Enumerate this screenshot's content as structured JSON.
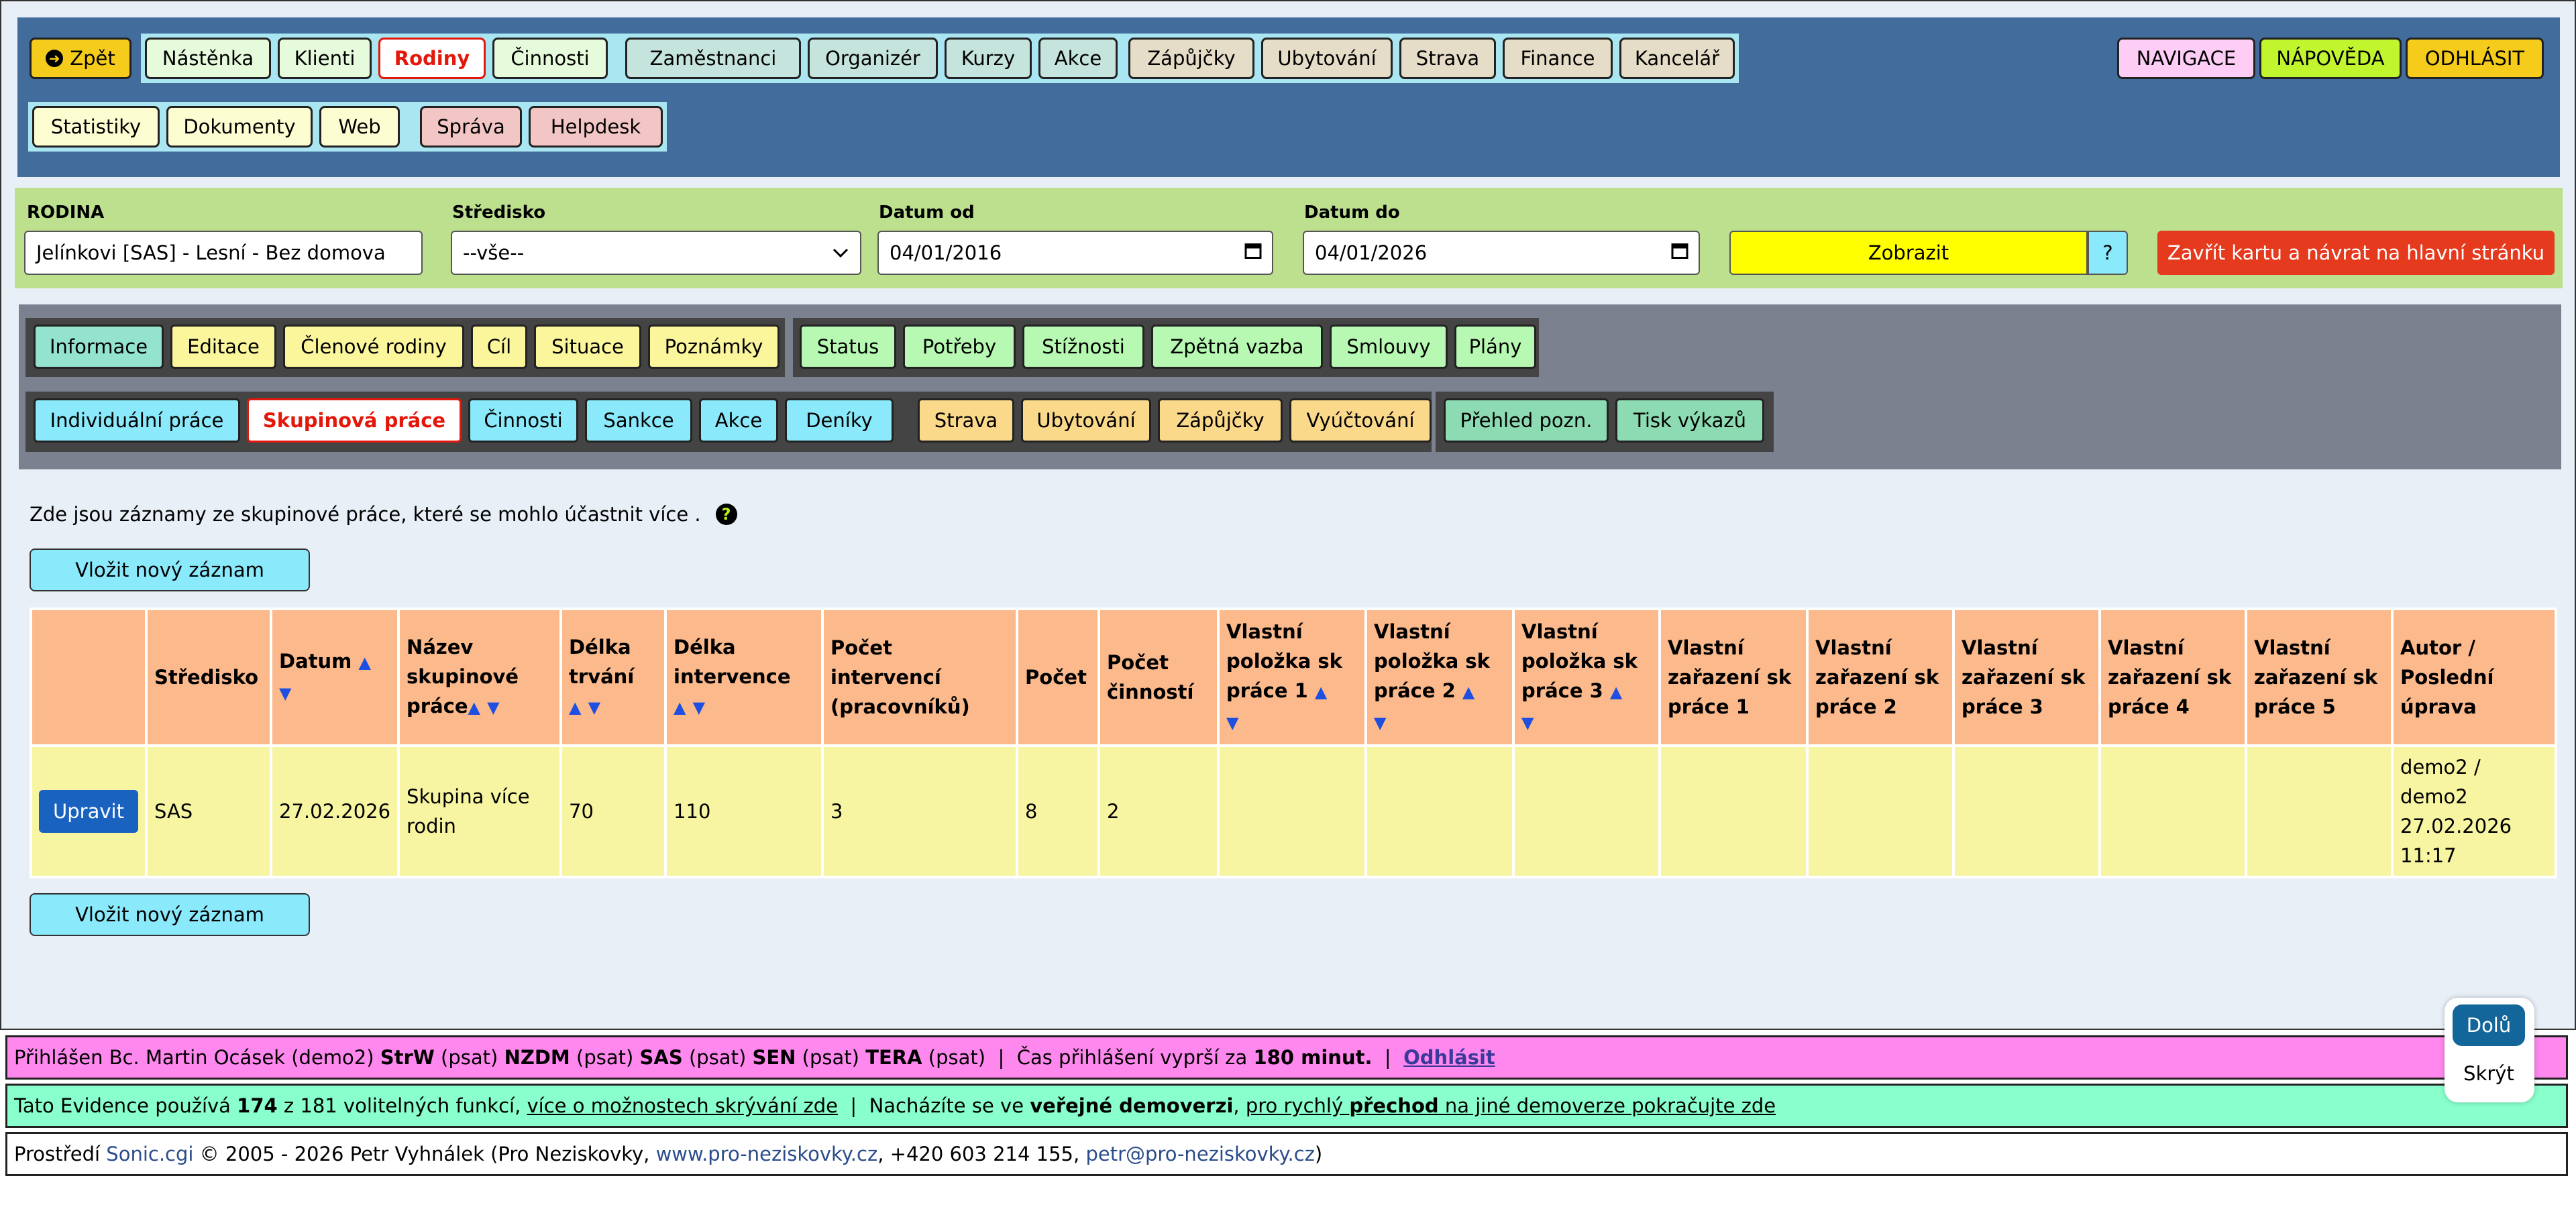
{
  "topnav": {
    "back": "Zpět",
    "group1": [
      "Nástěnka",
      "Klienti",
      "Rodiny",
      "Činnosti"
    ],
    "group2": [
      "Zaměstnanci",
      "Organizér",
      "Kurzy",
      "Akce"
    ],
    "group3": [
      "Zápůjčky",
      "Ubytování",
      "Strava",
      "Finance",
      "Kancelář"
    ],
    "row2_group1": [
      "Statistiky",
      "Dokumenty",
      "Web"
    ],
    "row2_group2": [
      "Správa",
      "Helpdesk"
    ],
    "navigace": "NAVIGACE",
    "napoveda": "NÁPOVĚDA",
    "odhlasit": "ODHLÁSIT"
  },
  "filter": {
    "rodina_label": "RODINA",
    "rodina_value": "Jelínkovi [SAS] - Lesní - Bez domova",
    "stredisko_label": "Středisko",
    "stredisko_value": "--vše--",
    "datum_od_label": "Datum od",
    "datum_od_value": "04/01/2016",
    "datum_do_label": "Datum do",
    "datum_do_value": "04/01/2026",
    "zobrazit": "Zobrazit",
    "help": "?",
    "zavrit": "Zavřít kartu a návrat na hlavní stránku"
  },
  "subnav": {
    "g1": [
      "Informace",
      "Editace",
      "Členové rodiny",
      "Cíl",
      "Situace",
      "Poznámky"
    ],
    "g2": [
      "Status",
      "Potřeby",
      "Stížnosti",
      "Zpětná vazba",
      "Smlouvy",
      "Plány"
    ],
    "g3": [
      "Individuální práce",
      "Skupinová práce",
      "Činnosti",
      "Sankce",
      "Akce",
      "Deníky"
    ],
    "g4": [
      "Strava",
      "Ubytování",
      "Zápůjčky",
      "Vyúčtování"
    ],
    "g5": [
      "Přehled pozn.",
      "Tisk výkazů"
    ]
  },
  "intro": "Zde jsou záznamy ze skupinové práce, které se mohlo účastnit více .",
  "new_record": "Vložit nový záznam",
  "table": {
    "headers": [
      "Středisko",
      "Datum",
      "Název skupinové práce",
      "Délka trvání",
      "Délka intervence",
      "Počet intervencí (pracovníků)",
      "Počet",
      "Počet činností",
      "Vlastní položka sk práce 1",
      "Vlastní položka sk práce 2",
      "Vlastní položka sk práce 3",
      "Vlastní zařazení sk práce 1",
      "Vlastní zařazení sk práce 2",
      "Vlastní zařazení sk práce 3",
      "Vlastní zařazení sk práce 4",
      "Vlastní zařazení sk práce 5",
      "Autor / Poslední úprava"
    ],
    "sort_up": "▲",
    "sort_down": "▼",
    "edit_label": "Upravit",
    "row": [
      "SAS",
      "27.02.2026",
      "Skupina více rodin",
      "70",
      "110",
      "3",
      "8",
      "2",
      "",
      "",
      "",
      "",
      "",
      "",
      "",
      "",
      "demo2 / demo2 27.02.2026 11:17"
    ]
  },
  "status": {
    "p1": "Přihlášen Bc. Martin Ocásek (demo2) ",
    "b1": "StrW",
    "p2": " (psat) ",
    "b2": "NZDM",
    "p3": " (psat) ",
    "b3": "SAS",
    "p4": " (psat) ",
    "b4": "SEN",
    "p5": " (psat) ",
    "b5": "TERA",
    "p6": " (psat)  |  Čas přihlášení vyprší za ",
    "b6": "180 minut.",
    "p7": "  |  ",
    "logout": "Odhlásit"
  },
  "info": {
    "p1": "Tato Evidence používá ",
    "b1": "174",
    "p2": " z 181 volitelných funkcí, ",
    "l1": "více o možnostech skrývání zde",
    "p3": "  |  Nacházíte se ve ",
    "b2": "veřejné demoverzi",
    "p4": ", ",
    "l2a": "pro rychlý ",
    "l2b": "přechod",
    "l2c": " na jiné demoverze pokračujte zde"
  },
  "footer": {
    "p1": "Prostředí ",
    "l1": "Sonic.cgi",
    "p2": " © 2005 - 2026 Petr Vyhnálek (Pro Neziskovky, ",
    "l2": "www.pro-neziskovky.cz",
    "p3": ", +420 603 214 155, ",
    "l3": "petr@pro-neziskovky.cz",
    "p4": ")"
  },
  "corner": {
    "down": "Dolů",
    "hide": "Skrýt"
  },
  "colors": {
    "nav_bg": "#426c9c",
    "filter_bg": "#bde08f",
    "subnav_bg": "#7c8190",
    "header_bg": "#fbb98c",
    "row_bg": "#f7f5a1",
    "status_bg": "#ff88ee",
    "info_bg": "#88ffcc",
    "active_red": "#e3170a"
  }
}
